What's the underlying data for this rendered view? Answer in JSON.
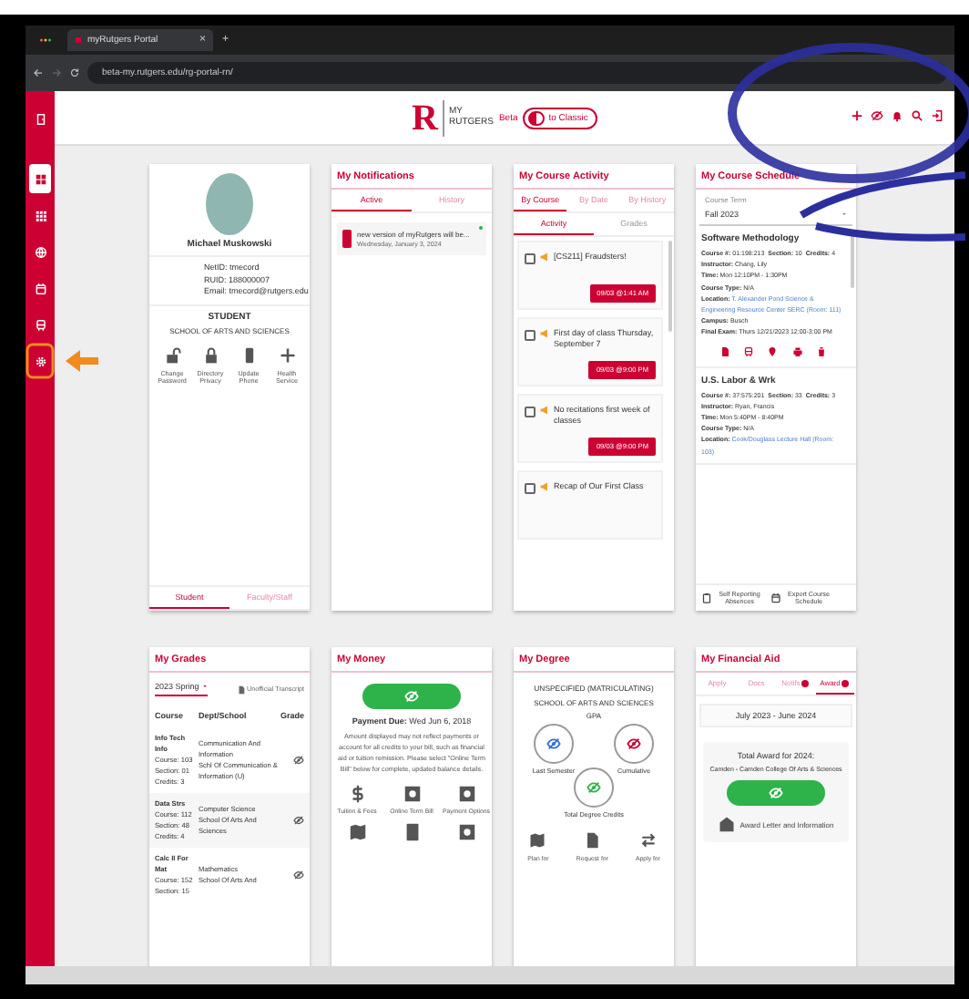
{
  "browser": {
    "tab_title": "myRutgers Portal",
    "tab_close": "×",
    "new_tab": "+",
    "url": "beta-my.rutgers.edu/rg-portal-rn/"
  },
  "header": {
    "logo_letter": "R",
    "logo_top": "MY",
    "logo_bottom": "RUTGERS",
    "beta": "Beta",
    "toggle_label": "to Classic"
  },
  "sidebar": {
    "items": [
      {
        "selected": true
      },
      {
        "selected": false
      },
      {
        "selected": false
      },
      {
        "selected": false
      },
      {
        "selected": false
      },
      {
        "selected": false
      }
    ]
  },
  "profile": {
    "name": "Michael Muskowski",
    "details": [
      "NetID: tmecord",
      "RUID: 188000007",
      "Email: tmecord@rutgers.edu"
    ],
    "role": "STUDENT",
    "school": "SCHOOL OF ARTS AND SCIENCES",
    "actions": [
      "Change Password",
      "Directory Privacy",
      "Update Phone",
      "Health Service"
    ],
    "tabs": [
      {
        "label": "Student",
        "selected": true
      },
      {
        "label": "Faculty/Staff",
        "selected": false
      }
    ]
  },
  "notifications": {
    "title": "My Notifications",
    "tabs": [
      {
        "label": "Active",
        "selected": true
      },
      {
        "label": "History",
        "selected": false
      }
    ],
    "items": [
      {
        "text": "new version of myRutgers will be...",
        "date": "Wednesday, January 3, 2024",
        "unread": true
      }
    ]
  },
  "course_activity": {
    "title": "My Course Activity",
    "tabs": [
      {
        "label": "By Course",
        "selected": true
      },
      {
        "label": "By Date",
        "selected": false
      },
      {
        "label": "By History",
        "selected": false
      }
    ],
    "subtabs": [
      {
        "label": "Activity",
        "selected": true
      },
      {
        "label": "Grades",
        "selected": false
      }
    ],
    "items": [
      {
        "text": "[CS211] Fraudsters!",
        "time": "09/03 @1:41 AM",
        "checked": false
      },
      {
        "text": "First day of class Thursday, September 7",
        "time": "09/03 @9:00 PM",
        "checked": false
      },
      {
        "text": "No recitations first week of classes",
        "time": "09/03 @9:00 PM",
        "checked": false
      },
      {
        "text": "Recap of Our First Class",
        "checked": false
      }
    ]
  },
  "course_schedule": {
    "title": "My Course Schedule",
    "term_label": "Course Term",
    "term": "Fall 2023",
    "courses": [
      {
        "name": "Software Methodology",
        "show_actions": true,
        "lines": [
          [
            {
              "label": "Course #:",
              "value": "01:198:213",
              "link": false
            },
            {
              "label": "Section:",
              "value": "10",
              "link": false
            },
            {
              "label": "Credits:",
              "value": "4",
              "link": false
            }
          ],
          [
            {
              "label": "Instructor:",
              "value": "Chang, Lily",
              "link": false
            }
          ],
          [
            {
              "label": "Time:",
              "value": "Mon 12:10PM - 1:30PM",
              "link": false
            }
          ],
          [
            {
              "label": "Course Type:",
              "value": "N/A",
              "link": false
            }
          ],
          [
            {
              "label": "Location:",
              "value": "T. Alexander Pond Science & Engineering Resource Center SERC (Room: 111)",
              "link": true
            }
          ],
          [
            {
              "label": "Campus:",
              "value": "Busch",
              "link": false
            }
          ],
          [
            {
              "label": "Final Exam:",
              "value": "Thurs 12/21/2023 12:00-3:00 PM",
              "link": false
            }
          ]
        ]
      },
      {
        "name": "U.S. Labor & Wrk",
        "show_actions": false,
        "lines": [
          [
            {
              "label": "Course #:",
              "value": "37:575:201",
              "link": false
            },
            {
              "label": "Section:",
              "value": "33",
              "link": false
            },
            {
              "label": "Credits:",
              "value": "3",
              "link": false
            }
          ],
          [
            {
              "label": "Instructor:",
              "value": "Ryan, Francis",
              "link": false
            }
          ],
          [
            {
              "label": "Time:",
              "value": "Mon 5:40PM - 8:40PM",
              "link": false
            }
          ],
          [
            {
              "label": "Course Type:",
              "value": "N/A",
              "link": false
            }
          ],
          [
            {
              "label": "Location:",
              "value": "Cook/Douglass Lecture Hall (Room: 103)",
              "link": true
            }
          ]
        ]
      }
    ],
    "footer_actions": [
      "Self Reporting Absences",
      "Export Course Schedule"
    ]
  },
  "grades": {
    "title": "My Grades",
    "term": "2023 Spring",
    "transcript": "Unofficial Transcript",
    "columns": [
      "Course",
      "Dept/School",
      "Grade"
    ],
    "rows": [
      {
        "course": [
          "Info Tech Info",
          "Course: 103",
          "Section: 01",
          "Credits: 3"
        ],
        "dept": [
          "Communication And Information",
          "Schl Of Communication & Information (U)"
        ]
      },
      {
        "course": [
          "Data Strs",
          "Course: 112",
          "Section: 48",
          "Credits: 4"
        ],
        "dept": [
          "Computer Science",
          "School Of Arts And Sciences"
        ]
      },
      {
        "course": [
          "Calc II For Mat",
          "Course: 152",
          "Section: 15"
        ],
        "dept": [
          "Mathematics",
          "School Of Arts And"
        ]
      }
    ]
  },
  "money": {
    "title": "My Money",
    "due": "**Payment Due:** Wed Jun 6, 2018",
    "note": "Amount displayed may not reflect payments or account for all credits to your bill, such as financial aid or tuition remission. Please select \"Online Term Bill\" below for complete, updated balance details.",
    "links": [
      "Tuition & Fees",
      "Online Term Bill",
      "Payment Options"
    ]
  },
  "degree": {
    "title": "My Degree",
    "program": "UNSPECIFIED (MATRICULATING)",
    "school": "SCHOOL OF ARTS AND SCIENCES",
    "gpa_label": "GPA",
    "stats": [
      {
        "label": "Last Semester",
        "color": "#2f6fd6"
      },
      {
        "label": "Cumulative",
        "color": "#cc0033"
      },
      {
        "label": "Total Degree Credits",
        "color": "#2db34a"
      }
    ],
    "links": [
      "Plan for",
      "Request for",
      "Apply for"
    ]
  },
  "financial_aid": {
    "title": "My Financial Aid",
    "tabs": [
      {
        "label": "Apply",
        "selected": false,
        "badge": false
      },
      {
        "label": "Docs",
        "selected": false,
        "badge": false
      },
      {
        "label": "Notifs",
        "selected": false,
        "badge": true
      },
      {
        "label": "Award",
        "selected": true,
        "badge": true
      }
    ],
    "period": "July 2023 - June 2024",
    "award_title": "Total Award for 2024:",
    "school": "Camden - Camden College Of Arts & Sciences",
    "letter": "Award Letter and Information"
  }
}
